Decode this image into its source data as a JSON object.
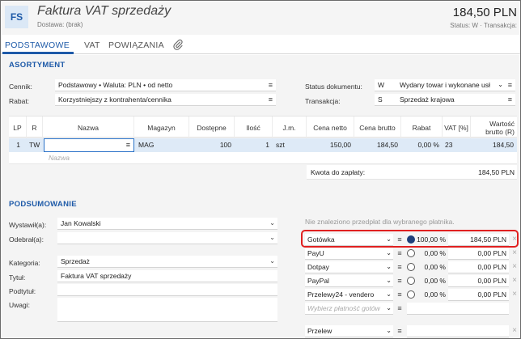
{
  "header": {
    "badge": "FS",
    "title": "Faktura VAT sprzedaży",
    "subtitle": "Dostawa: (brak)",
    "amount": "184,50 PLN",
    "status": "Status: W · Transakcja:"
  },
  "tabs": [
    {
      "label": "PODSTAWOWE",
      "active": true
    },
    {
      "label": "VAT",
      "active": false
    },
    {
      "label": "POWIĄZANIA",
      "active": false
    }
  ],
  "assortment": {
    "title": "ASORTYMENT",
    "cennik_label": "Cennik:",
    "cennik_value": "Podstawowy • Waluta: PLN • od netto",
    "rabat_label": "Rabat:",
    "rabat_value": "Korzystniejszy z kontrahenta/cennika",
    "status_label": "Status dokumentu:",
    "status_code": "W",
    "status_value": "Wydany towar i wykonane usł",
    "transakcja_label": "Transakcja:",
    "transakcja_code": "S",
    "transakcja_value": "Sprzedaż krajowa"
  },
  "table": {
    "columns": [
      "LP",
      "R",
      "Nazwa",
      "Magazyn",
      "Dostępne",
      "Ilość",
      "J.m.",
      "Cena netto",
      "Cena brutto",
      "Rabat",
      "VAT [%]",
      "Wartość brutto (R)"
    ],
    "row": {
      "lp": "1",
      "r": "TW",
      "nazwa": "",
      "magazyn": "MAG",
      "dostepne": "100",
      "ilosc": "1",
      "jm": "szt",
      "cena_netto": "150,00",
      "cena_brutto": "184,50",
      "rabat": "0,00 %",
      "vat": "23",
      "wartosc": "184,50"
    },
    "new_row_placeholder": "Nazwa",
    "total_label": "Kwota do zapłaty:",
    "total_value": "184,50 PLN"
  },
  "summary": {
    "title": "PODSUMOWANIE",
    "wystawil_label": "Wystawił(a):",
    "wystawil_value": "Jan Kowalski",
    "odebral_label": "Odebrał(a):",
    "odebral_value": "",
    "kategoria_label": "Kategoria:",
    "kategoria_value": "Sprzedaż",
    "tytul_label": "Tytuł:",
    "tytul_value": "Faktura VAT sprzedaży",
    "podtytul_label": "Podtytuł:",
    "podtytul_value": "",
    "uwagi_label": "Uwagi:",
    "uwagi_value": ""
  },
  "payments": {
    "note": "Nie znaleziono przedpłat dla wybranego płatnika.",
    "rows": [
      {
        "name": "Gotówka",
        "selected": true,
        "percent": "100,00 %",
        "amount": "184,50 PLN"
      },
      {
        "name": "PayU",
        "selected": false,
        "percent": "0,00 %",
        "amount": "0,00 PLN"
      },
      {
        "name": "Dotpay",
        "selected": false,
        "percent": "0,00 %",
        "amount": "0,00 PLN"
      },
      {
        "name": "PayPal",
        "selected": false,
        "percent": "0,00 %",
        "amount": "0,00 PLN"
      },
      {
        "name": "Przelewy24 - vendero",
        "selected": false,
        "percent": "0,00 %",
        "amount": "0,00 PLN"
      }
    ],
    "choose_placeholder": "Wybierz płatność gotów",
    "przelew_label": "Przelew"
  },
  "icons": {
    "menu": "hamburger-icon",
    "dropdown": "chevron-down-icon",
    "attachment": "paperclip-icon",
    "remove": "close-icon"
  },
  "colors": {
    "accent": "#1e5aa8",
    "highlight_row": "#deeaf7",
    "annotation_box": "#e02020"
  }
}
